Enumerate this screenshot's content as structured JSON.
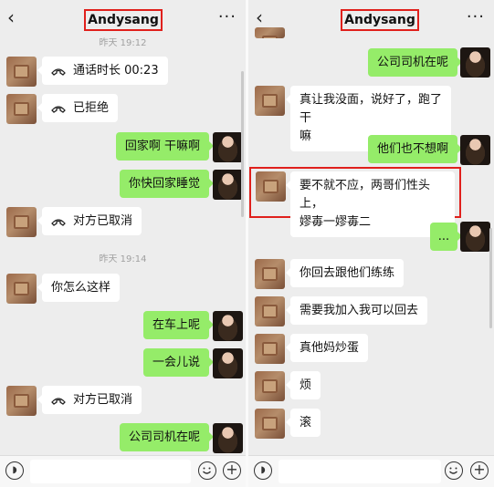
{
  "left": {
    "header": {
      "back_glyph": "‹",
      "title": "Andysang",
      "more_glyph": "···"
    },
    "timestamps": [
      "昨天 19:12",
      "昨天 19:14"
    ],
    "messages": [
      {
        "side": "in",
        "icon": "phone-hangup-icon",
        "text": "通话时长 00:23"
      },
      {
        "side": "in",
        "icon": "phone-hangup-icon",
        "text": "已拒绝"
      },
      {
        "side": "out",
        "text": "回家啊 干嘛啊"
      },
      {
        "side": "out",
        "text": "你快回家睡觉"
      },
      {
        "side": "in",
        "icon": "phone-hangup-icon",
        "text": "对方已取消"
      },
      {
        "side": "in",
        "text": "你怎么这样"
      },
      {
        "side": "out",
        "text": "在车上呢"
      },
      {
        "side": "out",
        "text": "一会儿说"
      },
      {
        "side": "in",
        "icon": "phone-hangup-icon",
        "text": "对方已取消"
      },
      {
        "side": "out",
        "text": "公司司机在呢"
      }
    ]
  },
  "right": {
    "header": {
      "back_glyph": "‹",
      "title": "Andysang",
      "more_glyph": "···"
    },
    "messages": [
      {
        "side": "out",
        "text": "公司司机在呢"
      },
      {
        "side": "in",
        "text_line1": "真让我没面，说好了，跑了干",
        "text_line2": "嘛"
      },
      {
        "side": "out",
        "text": "他们也不想啊"
      },
      {
        "side": "in",
        "text_line1": "要不就不应，两哥们性头上，",
        "text_line2": "嫪毐一嫪毐二",
        "highlighted": true
      },
      {
        "side": "out",
        "text": "..."
      },
      {
        "side": "in",
        "text": "你回去跟他们练练"
      },
      {
        "side": "in",
        "text": "需要我加入我可以回去"
      },
      {
        "side": "in",
        "text": "真他妈炒蛋"
      },
      {
        "side": "in",
        "text": "烦"
      },
      {
        "side": "in",
        "text": "滚"
      }
    ]
  },
  "colors": {
    "accent_red": "#e0201c",
    "bubble_green": "#95ec69",
    "bubble_white": "#ffffff",
    "bg": "#ededed"
  }
}
